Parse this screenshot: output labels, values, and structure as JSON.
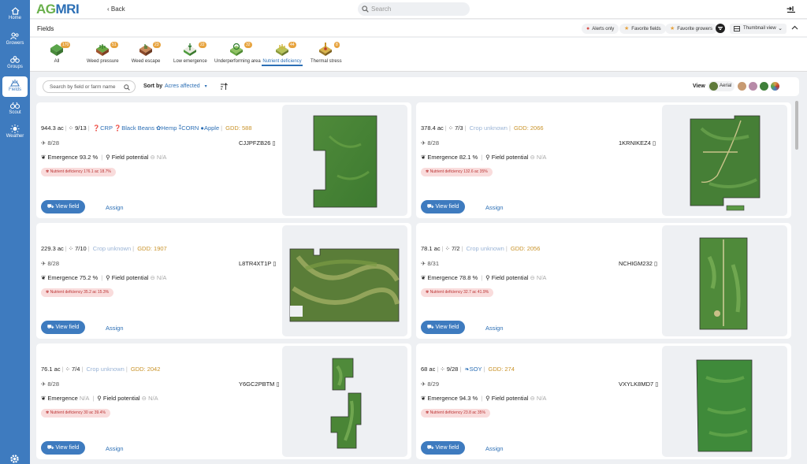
{
  "nav": [
    {
      "label": "Home",
      "icon": "home-icon"
    },
    {
      "label": "Growers",
      "icon": "users-icon"
    },
    {
      "label": "Groups",
      "icon": "groups-icon"
    },
    {
      "label": "Fields",
      "icon": "fields-icon",
      "active": true
    },
    {
      "label": "Scout",
      "icon": "scout-icon"
    },
    {
      "label": "Weather",
      "icon": "sun-icon"
    }
  ],
  "brand": {
    "part1": "AG",
    "part2": "MRI"
  },
  "topbar": {
    "back_label": "Back",
    "search_placeholder": "Search"
  },
  "header": {
    "title": "Fields",
    "alerts_only": "Alerts only",
    "favorite_fields": "Favorite fields",
    "favorite_growers": "Favorite growers",
    "view_mode": "Thumbnail view"
  },
  "alert_tabs": [
    {
      "label": "All",
      "count": "170",
      "color": "#5aa54a"
    },
    {
      "label": "Weed pressure",
      "count": "51",
      "color": "#a0552f"
    },
    {
      "label": "Weed escape",
      "count": "23",
      "color": "#8b4a2b"
    },
    {
      "label": "Low emergence",
      "count": "22",
      "color": "#4f9b3e"
    },
    {
      "label": "Underperforming area",
      "count": "32",
      "color": "#6aa843"
    },
    {
      "label": "Nutrient deficiency",
      "count": "44",
      "color": "#d2b43a",
      "active": true
    },
    {
      "label": "Thermal stress",
      "count": "8",
      "color": "#c9932a"
    }
  ],
  "toolbar": {
    "search_placeholder": "Search by field or farm name",
    "sort_label": "Sort by",
    "sort_value": "Acres affected",
    "view_label": "View",
    "layers": [
      {
        "name": "Aerial",
        "color": "#5e7a3a"
      },
      {
        "name": "",
        "color": "#c79a72"
      },
      {
        "name": "",
        "color": "#b78aa8"
      },
      {
        "name": "",
        "color": "#3f7f3a"
      },
      {
        "name": "",
        "color": "#d7a04a"
      }
    ]
  },
  "cards": [
    {
      "acres": "944.3 ac",
      "scouts": "9/13",
      "crops": [
        "CRP",
        "Black Beans",
        "Hemp",
        "CORN",
        "Apple"
      ],
      "gdd": "GDD: 588",
      "date": "8/28",
      "field_id": "CJJPFZB26",
      "emergence": "93.2 %",
      "field_potential": "N/A",
      "nutrient": "Nutrient deficiency  176.1 ac  18.7%",
      "view_btn": "View field",
      "assign": "Assign"
    },
    {
      "acres": "378.4 ac",
      "scouts": "7/3",
      "crops_unknown": "Crop unknown",
      "gdd": "GDD: 2066",
      "date": "8/28",
      "field_id": "1KRNIKEZ4",
      "emergence": "82.1 %",
      "field_potential": "N/A",
      "nutrient": "Nutrient deficiency  132.6 ac  35%",
      "view_btn": "View field",
      "assign": "Assign"
    },
    {
      "acres": "229.3 ac",
      "scouts": "7/10",
      "crops_unknown": "Crop unknown",
      "gdd": "GDD: 1907",
      "date": "8/28",
      "field_id": "L8TR4XT1P",
      "emergence": "75.2 %",
      "field_potential": "N/A",
      "nutrient": "Nutrient deficiency  35.2 ac  15.3%",
      "view_btn": "View field",
      "assign": "Assign"
    },
    {
      "acres": "78.1 ac",
      "scouts": "7/2",
      "crops_unknown": "Crop unknown",
      "gdd": "GDD: 2056",
      "date": "8/31",
      "field_id": "NCHIGM232",
      "emergence": "78.8 %",
      "field_potential": "N/A",
      "nutrient": "Nutrient deficiency  32.7 ac  41.9%",
      "view_btn": "View field",
      "assign": "Assign"
    },
    {
      "acres": "76.1 ac",
      "scouts": "7/4",
      "crops_unknown": "Crop unknown",
      "gdd": "GDD: 2042",
      "date": "8/28",
      "field_id": "Y6GC2PBTM",
      "emergence": "N/A",
      "field_potential": "N/A",
      "nutrient": "Nutrient deficiency  30 ac  39.4%",
      "view_btn": "View field",
      "assign": "Assign"
    },
    {
      "acres": "68 ac",
      "scouts": "9/28",
      "crops": [
        "SOY"
      ],
      "gdd": "GDD: 274",
      "date": "8/29",
      "field_id": "VXYLK8MD7",
      "emergence": "94.3 %",
      "field_potential": "N/A",
      "nutrient": "Nutrient deficiency  23.8 ac  35%",
      "view_btn": "View field",
      "assign": "Assign"
    }
  ]
}
